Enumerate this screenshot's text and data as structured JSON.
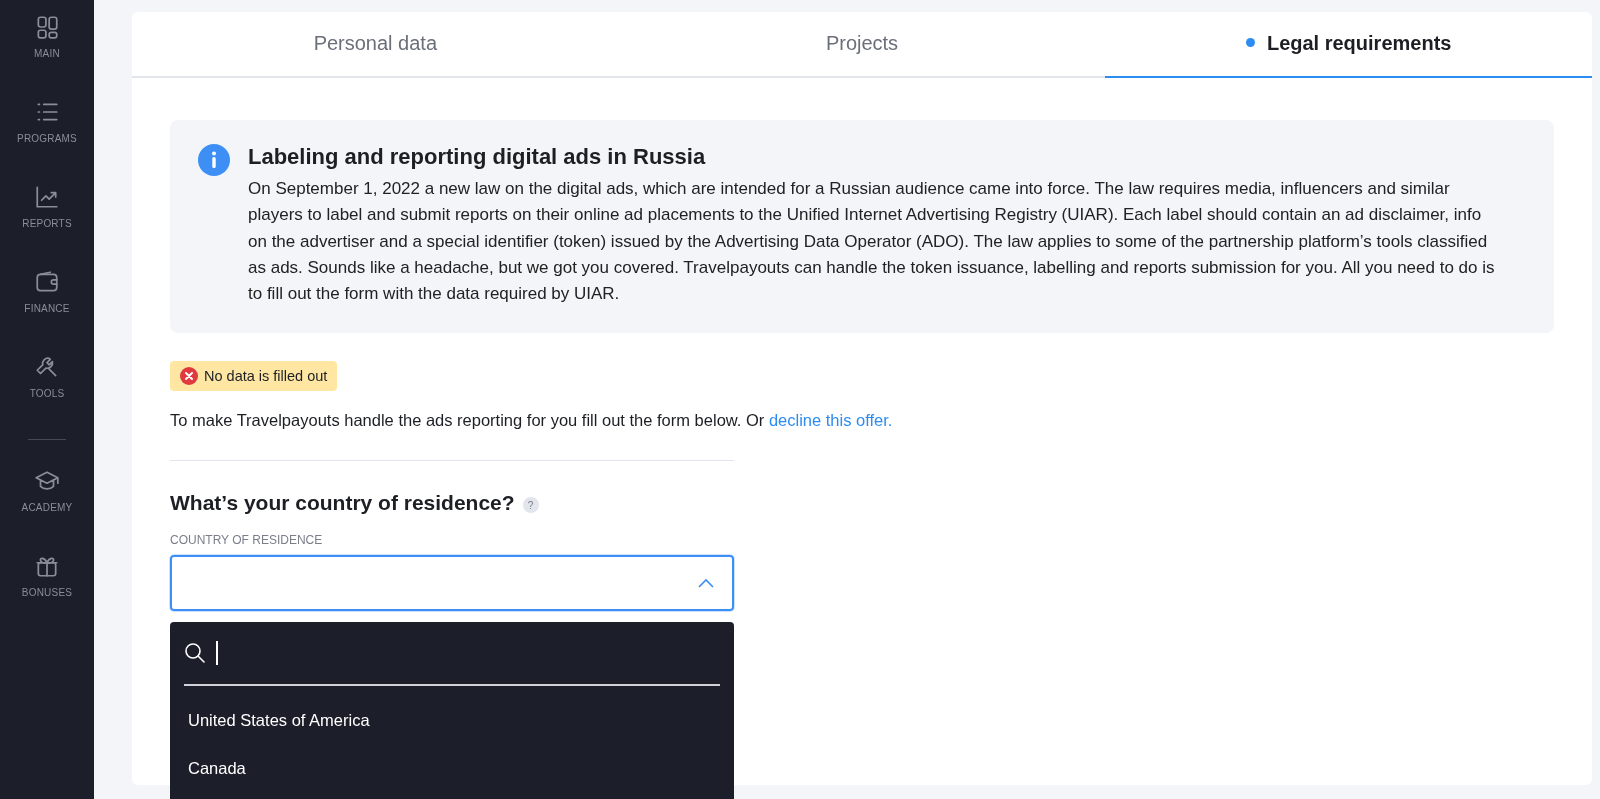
{
  "sidebar": {
    "items": [
      {
        "label": "MAIN",
        "kind": "grid"
      },
      {
        "label": "PROGRAMS",
        "kind": "list"
      },
      {
        "label": "REPORTS",
        "kind": "chart"
      },
      {
        "label": "FINANCE",
        "kind": "wallet"
      },
      {
        "label": "TOOLS",
        "kind": "wrench",
        "divider_after": true
      },
      {
        "label": "ACADEMY",
        "kind": "cap"
      },
      {
        "label": "BONUSES",
        "kind": "gift"
      }
    ]
  },
  "tabs": [
    {
      "label": "Personal data",
      "selected": false
    },
    {
      "label": "Projects",
      "selected": false
    },
    {
      "label": "Legal requirements",
      "selected": true
    }
  ],
  "info": {
    "title": "Labeling and reporting digital ads in Russia",
    "body": "On September 1, 2022 a new law on the digital ads, which are intended for a Russian audience came into force. The law requires media, influencers and similar players to label and submit reports on their online ad placements to the Unified Internet Advertising Registry (UIAR). Each label should contain an ad disclaimer, info on the advertiser and a special identifier (token) issued by the Advertising Data Operator (ADO). The law applies to some of the partnership platform’s tools classified as ads. Sounds like a headache, but we got you covered. Travelpayouts can handle the token issuance, labelling and reports submission for you. All you need to do is to fill out the form with the data required by UIAR."
  },
  "status_badge": {
    "label": "No data is filled out"
  },
  "intro": {
    "text": "To make Travelpayouts handle the ads reporting for you fill out the form below. Or ",
    "link": "decline this offer."
  },
  "question": {
    "title": "What’s your country of residence?",
    "help": "?"
  },
  "country_field": {
    "label": "COUNTRY OF RESIDENCE",
    "expanded": true
  },
  "dropdown": {
    "options": [
      {
        "label": "United States of America"
      },
      {
        "label": "Canada"
      }
    ]
  }
}
